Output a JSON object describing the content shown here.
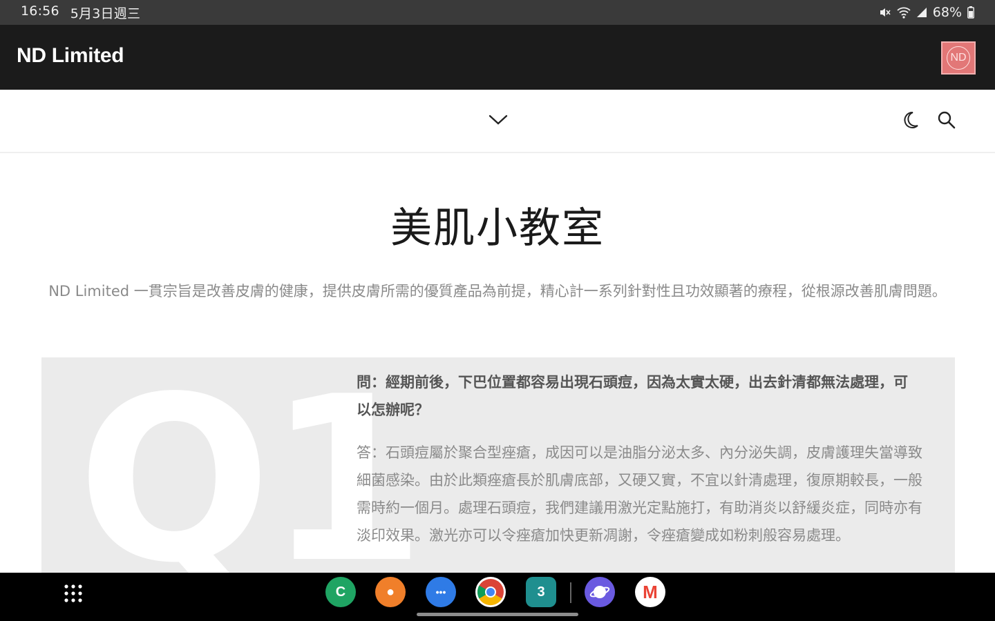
{
  "status_bar": {
    "time": "16:56",
    "date": "5月3日週三",
    "battery": "68%"
  },
  "app_bar": {
    "title": "ND Limited",
    "avatar_text": "ND",
    "avatar_color": "#e27777"
  },
  "nav": {
    "menu_toggle_icon": "chevron-down-icon",
    "dark_mode_icon": "moon-icon",
    "search_icon": "search-icon"
  },
  "page": {
    "title": "美肌小教室",
    "intro": "ND Limited 一貫宗旨是改善皮膚的健康，提供皮膚所需的優質產品為前提，精心計一系列針對性且功效顯著的療程，從根源改善肌膚問題。",
    "qa": [
      {
        "label": "Q1",
        "question": "問：經期前後，下巴位置都容易出現石頭痘，因為太實太硬，出去針清都無法處理，可以怎辦呢？",
        "answer": "答：石頭痘屬於聚合型痤瘡，成因可以是油脂分泌太多、內分泌失調，皮膚護理失當導致細菌感染。由於此類痤瘡長於肌膚底部，又硬又實，不宜以針清處理，復原期較長，一般需時約一個月。處理石頭痘，我們建議用激光定點施打，有助消炎以舒緩炎症，同時亦有淡印效果。激光亦可以令痤瘡加快更新凋謝，令痤瘡變成如粉刺般容易處理。"
      }
    ]
  },
  "dock": {
    "apps": [
      {
        "name": "phone-app-icon",
        "color": "#1fa463",
        "glyph": "C"
      },
      {
        "name": "contacts-app-icon",
        "color": "#f07f2a",
        "glyph": "●"
      },
      {
        "name": "messages-app-icon",
        "color": "#2f7be6",
        "glyph": "•••"
      },
      {
        "name": "chrome-app-icon",
        "color": "#ffffff",
        "glyph": ""
      },
      {
        "name": "calendar-app-icon",
        "color": "#1f8f8f",
        "glyph": "3"
      },
      {
        "name": "internet-app-icon",
        "color": "#6a5ae0",
        "glyph": ""
      },
      {
        "name": "gmail-app-icon",
        "color": "#ffffff",
        "glyph": "M"
      }
    ]
  }
}
